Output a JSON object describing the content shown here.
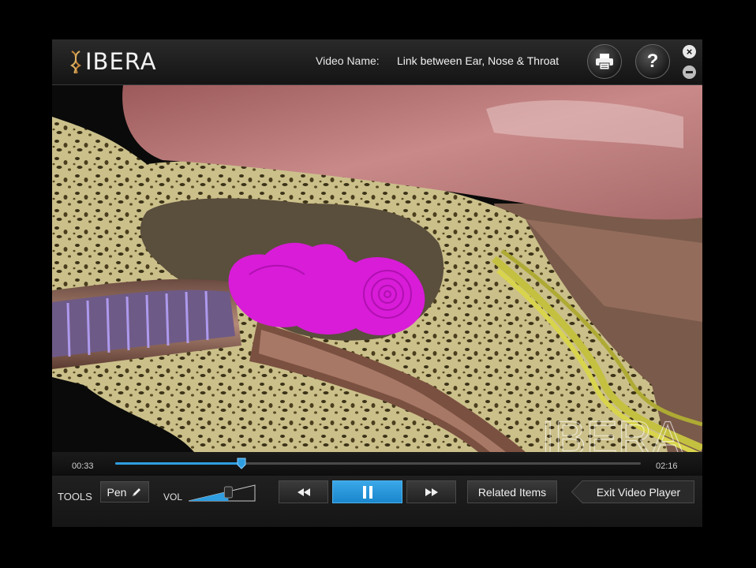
{
  "header": {
    "logo_text": "IBERA",
    "video_name_label": "Video Name:",
    "video_name": "Link between Ear, Nose & Throat",
    "help_label": "?",
    "close_label": "×"
  },
  "video": {
    "watermark": "IBERA"
  },
  "timeline": {
    "current_time": "00:33",
    "total_time": "02:16",
    "progress": 0.24
  },
  "controls": {
    "tools_label": "TOOLS",
    "pen_label": "Pen",
    "vol_label": "VOL",
    "volume": 0.6,
    "related_items_label": "Related Items",
    "exit_label": "Exit Video Player"
  },
  "icons": {
    "print": "printer-icon",
    "help": "question-icon",
    "close": "close-icon",
    "minimize": "minimize-icon",
    "pen": "pencil-icon",
    "rewind": "rewind-icon",
    "pause": "pause-icon",
    "forward": "fast-forward-icon"
  },
  "colors": {
    "accent": "#2f9ee0",
    "cochlea": "#d81cd8",
    "bone": "#c9bf86"
  }
}
